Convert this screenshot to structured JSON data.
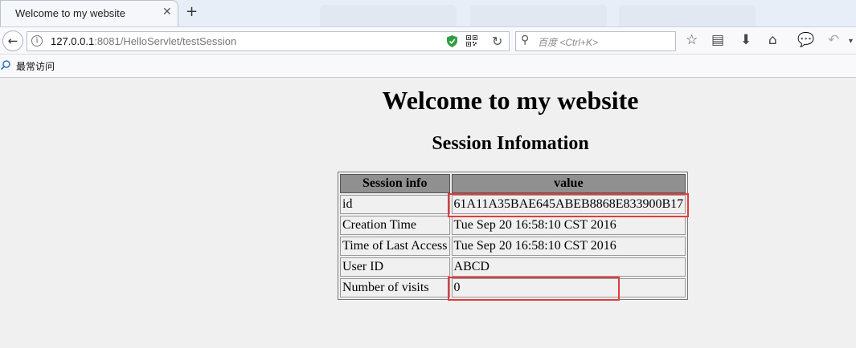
{
  "browser": {
    "tab_title": "Welcome to my website",
    "tab_close": "✕",
    "new_tab": "+",
    "url_host": "127.0.0.1",
    "url_rest": ":8081/HelloServlet/testSession",
    "search_placeholder": "百度 <Ctrl+K>",
    "bookmarks_label": "最常访问"
  },
  "page": {
    "title": "Welcome to my website",
    "subtitle": "Session Infomation",
    "table": {
      "headers": [
        "Session info",
        "value"
      ],
      "rows": [
        {
          "label": "id",
          "value": "61A11A35BAE645ABEB8868E833900B17"
        },
        {
          "label": "Creation Time",
          "value": "Tue Sep 20 16:58:10 CST 2016"
        },
        {
          "label": "Time of Last Access",
          "value": "Tue Sep 20 16:58:10 CST 2016"
        },
        {
          "label": "User ID",
          "value": "ABCD"
        },
        {
          "label": "Number of visits",
          "value": "0"
        }
      ]
    }
  },
  "colors": {
    "header_bg": "#909090",
    "highlight": "#e53a3a",
    "shield": "#2ea043"
  }
}
